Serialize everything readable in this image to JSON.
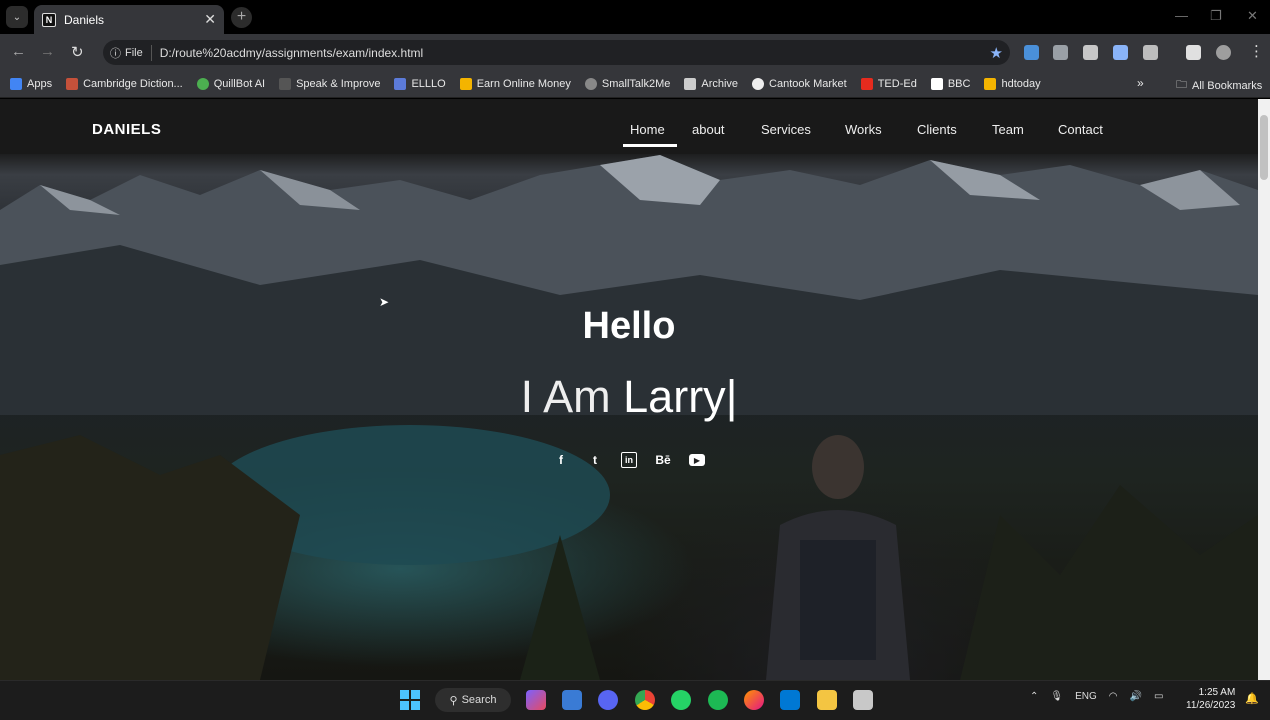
{
  "browser": {
    "tab_title": "Daniels",
    "tab_favicon": "N",
    "new_tab": "+",
    "url_chip": "File",
    "url": "D:/route%20acdmy/assignments/exam/index.html",
    "bookmarks": [
      {
        "label": "Apps",
        "color": "#4285f4"
      },
      {
        "label": "Cambridge Diction...",
        "color": "#c5513a"
      },
      {
        "label": "QuillBot AI",
        "color": "#4caf50"
      },
      {
        "label": "Speak & Improve",
        "color": "#555555"
      },
      {
        "label": "ELLLO",
        "color": "#5c7bd9"
      },
      {
        "label": "Earn Online Money",
        "color": "#f4b400"
      },
      {
        "label": "SmallTalk2Me",
        "color": "#888888"
      },
      {
        "label": "Archive",
        "color": "#cccccc"
      },
      {
        "label": "Cantook Market",
        "color": "#eeeeee"
      },
      {
        "label": "TED-Ed",
        "color": "#e62b1e"
      },
      {
        "label": "BBC",
        "color": "#ffffff"
      },
      {
        "label": "hdtoday",
        "color": "#f4b400"
      }
    ],
    "bookmarks_more": "»",
    "all_bookmarks": "All Bookmarks"
  },
  "site": {
    "brand": "DANIELS",
    "nav": [
      "Home",
      "about",
      "Services",
      "Works",
      "Clients",
      "Team",
      "Contact"
    ],
    "active_nav": "Home",
    "hero_title": "Hello",
    "hero_prefix": "I Am",
    "hero_name": "Larry",
    "hero_cursor": "|",
    "social": [
      "f",
      "t",
      "in",
      "Bē",
      "▶"
    ]
  },
  "taskbar": {
    "search_label": "Search",
    "language": "ENG",
    "time": "1:25 AM",
    "date": "11/26/2023"
  }
}
